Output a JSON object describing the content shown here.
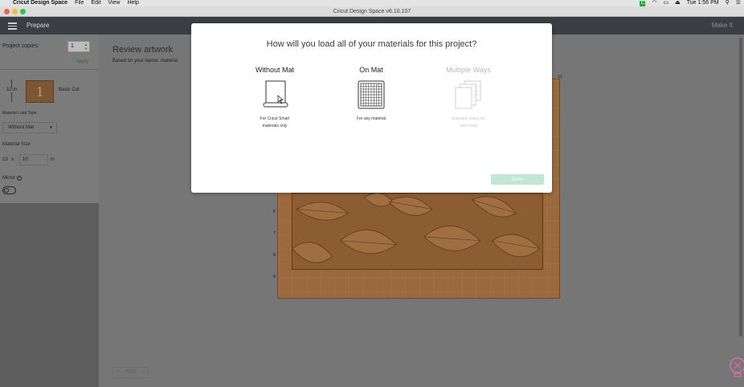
{
  "menubar": {
    "app_name": "Cricut Design Space",
    "items": [
      "File",
      "Edit",
      "View",
      "Help"
    ],
    "clock": "Tue 1:56 PM"
  },
  "window": {
    "title": "Cricut Design Space  v6.10.107"
  },
  "header": {
    "section": "Prepare",
    "next_step": "Make It"
  },
  "left_panel": {
    "copies_label": "Project copies:",
    "copies_value": "1",
    "apply_label": "Apply",
    "mat_size_label": "10 in",
    "mat_number": "1",
    "mat_name": "Basic Cut",
    "load_type_label": "Material Load Type",
    "load_type_value": "Without Mat",
    "material_size_label": "Material Size",
    "material_width": "13",
    "material_x": "x",
    "material_height": "10",
    "material_unit": "in",
    "mirror_label": "Mirror",
    "mirror_on": false
  },
  "main": {
    "title": "Review artwork",
    "subtitle": "Based on your layout, material",
    "zoom_value": "75%",
    "ruler_top": "10",
    "ruler_left": [
      "6",
      "7",
      "8",
      "9"
    ]
  },
  "modal": {
    "title": "How will you load all of your materials for this project?",
    "options": [
      {
        "title": "Without Mat",
        "desc_line1": "For Cricut Smart",
        "desc_line2": "materials only",
        "icon": "roll-icon"
      },
      {
        "title": "On Mat",
        "desc_line1": "For any material",
        "desc_line2": "",
        "icon": "mat-grid-icon"
      },
      {
        "title": "Multiple Ways",
        "desc_line1": "Manually select for",
        "desc_line2": "each load",
        "icon": "multi-sheet-icon"
      }
    ],
    "done_label": "Done"
  },
  "colors": {
    "header_bg": "#3b3f43",
    "mat": "#9a6a3e",
    "done_disabled": "#bfe6d6",
    "apply_green": "#2d6b3a"
  }
}
